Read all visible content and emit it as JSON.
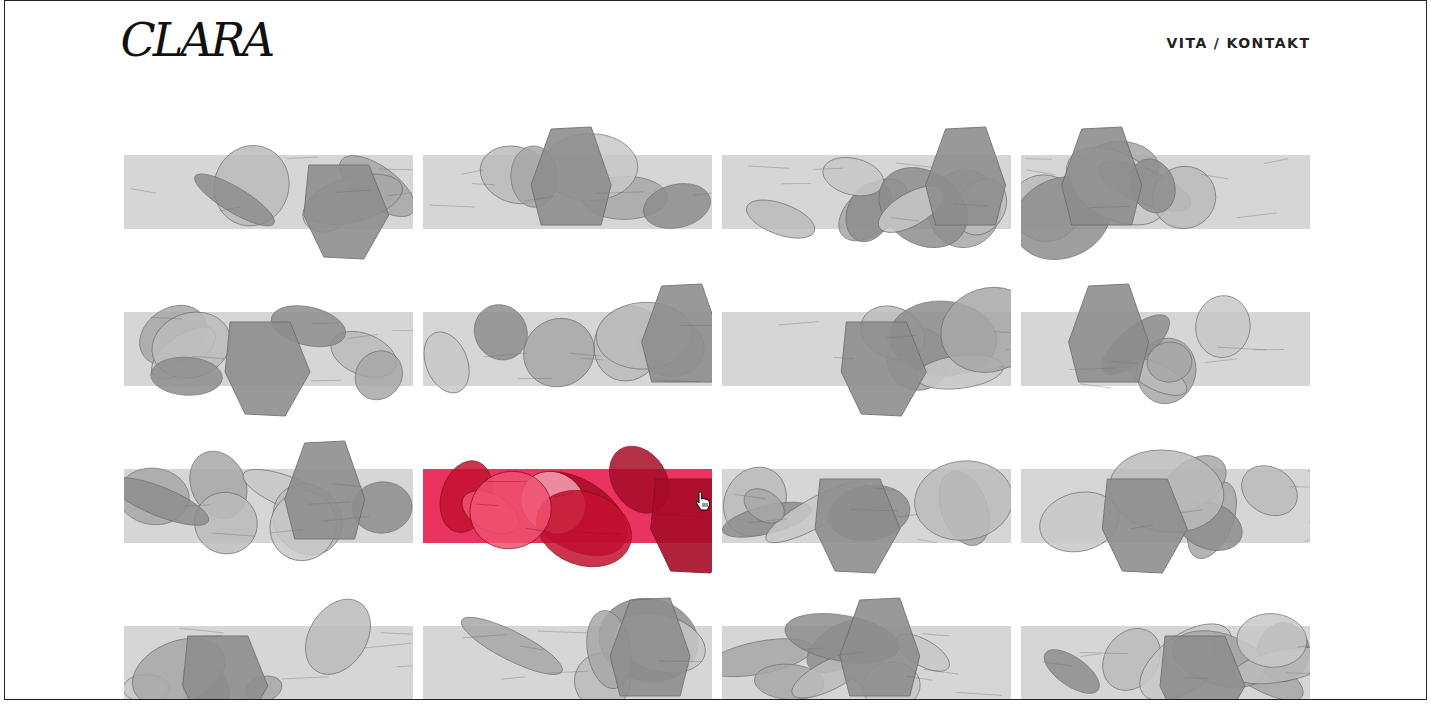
{
  "logo": "CLARA",
  "nav": {
    "items": [
      {
        "label": "VITA"
      },
      {
        "label": "KONTAKT"
      }
    ],
    "separator": "/"
  },
  "gallery": {
    "tiles": [
      {
        "hovered": false
      },
      {
        "hovered": false
      },
      {
        "hovered": false
      },
      {
        "hovered": false
      },
      {
        "hovered": false
      },
      {
        "hovered": false
      },
      {
        "hovered": false
      },
      {
        "hovered": false
      },
      {
        "hovered": false
      },
      {
        "hovered": true
      },
      {
        "hovered": false
      },
      {
        "hovered": false
      },
      {
        "hovered": false
      },
      {
        "hovered": false
      },
      {
        "hovered": false
      },
      {
        "hovered": false
      }
    ]
  }
}
